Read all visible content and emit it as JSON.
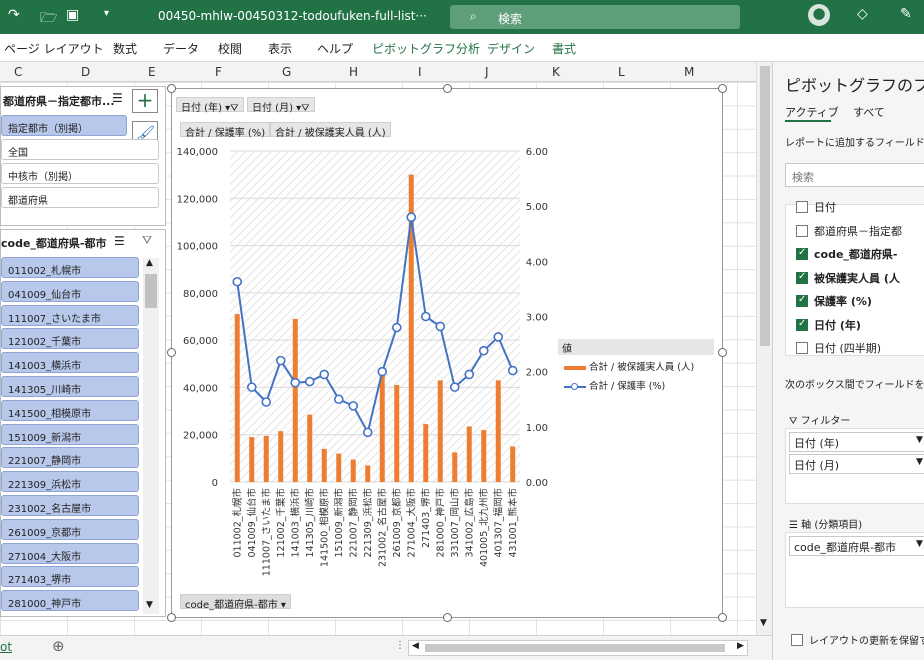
{
  "titlebar": {
    "filename": "00450-mhlw-00450312-todoufuken-full-list···",
    "search": "検索"
  },
  "ribbon": {
    "tabs": [
      "ページ レイアウト",
      "数式",
      "データ",
      "校閲",
      "表示",
      "ヘルプ",
      "ピボットグラフ分析",
      "デザイン",
      "書式"
    ]
  },
  "columns": [
    "C",
    "D",
    "E",
    "F",
    "G",
    "H",
    "I",
    "J",
    "K",
    "L",
    "M"
  ],
  "slicer1": {
    "title": "都道府県－指定都市...",
    "items": [
      "指定都市（別掲）",
      "全国",
      "中核市（別掲）",
      "都道府県"
    ]
  },
  "slicer2": {
    "title": "code_都道府県-都市",
    "items": [
      "011002_札幌市",
      "041009_仙台市",
      "111007_さいたま市",
      "121002_千葉市",
      "141003_横浜市",
      "141305_川崎市",
      "141500_相模原市",
      "151009_新潟市",
      "221007_静岡市",
      "221309_浜松市",
      "231002_名古屋市",
      "261009_京都市",
      "271004_大阪市",
      "271403_堺市",
      "281000_神戸市"
    ]
  },
  "chart": {
    "filter_buttons": [
      "日付 (年)",
      "日付 (月)"
    ],
    "value_buttons": [
      "合計 / 保護率 (%)",
      "合計 / 被保護実人員 (人)"
    ],
    "axis_button": "code_都道府県-都市",
    "legend_title": "値",
    "legend": [
      "合計 / 被保護実人員 (人)",
      "合計 / 保護率 (%)"
    ]
  },
  "chart_data": {
    "type": "bar",
    "categories": [
      "011002_札幌市",
      "041009_仙台市",
      "111007_さいたま市",
      "121002_千葉市",
      "141003_横浜市",
      "141305_川崎市",
      "141500_相模原市",
      "151009_新潟市",
      "221007_静岡市",
      "221309_浜松市",
      "231002_名古屋市",
      "261009_京都市",
      "271004_大阪市",
      "271403_堺市",
      "281000_神戸市",
      "331007_岡山市",
      "341002_広島市",
      "401005_北九州市",
      "401307_福岡市",
      "431001_熊本市"
    ],
    "series": [
      {
        "name": "合計 / 被保護実人員 (人)",
        "type": "bar",
        "axis": "left",
        "color": "#ED7D31",
        "values": [
          71000,
          19000,
          19500,
          21500,
          69000,
          28500,
          14000,
          12000,
          9500,
          7000,
          45000,
          41000,
          130000,
          24500,
          43000,
          12500,
          23500,
          22000,
          43000,
          15000
        ]
      },
      {
        "name": "合計 / 保護率 (%)",
        "type": "line",
        "axis": "right",
        "color": "#4472C4",
        "values": [
          3.63,
          1.72,
          1.45,
          2.2,
          1.8,
          1.82,
          1.95,
          1.5,
          1.38,
          0.9,
          2.0,
          2.8,
          4.8,
          3.0,
          2.82,
          1.72,
          1.95,
          2.38,
          2.63,
          2.02
        ]
      }
    ],
    "y_left": {
      "ticks": [
        "0",
        "20,000",
        "40,000",
        "60,000",
        "80,000",
        "100,000",
        "120,000",
        "140,000"
      ],
      "max": 140000
    },
    "y_right": {
      "ticks": [
        "0.00",
        "1.00",
        "2.00",
        "3.00",
        "4.00",
        "5.00",
        "6.00"
      ],
      "max": 6
    }
  },
  "pane": {
    "title": "ピボットグラフのフィ",
    "tabs": [
      "アクティブ",
      "すべて"
    ],
    "hint": "レポートに追加するフィールドを選",
    "search": "検索",
    "fields": [
      {
        "label": "日付",
        "checked": false
      },
      {
        "label": "都道府県－指定都",
        "checked": false
      },
      {
        "label": "code_都道府県-",
        "checked": true
      },
      {
        "label": "被保護実人員 (人",
        "checked": true
      },
      {
        "label": "保護率 (%)",
        "checked": true
      },
      {
        "label": "日付 (年)",
        "checked": true
      },
      {
        "label": "日付 (四半期)",
        "checked": false
      }
    ],
    "drag_hint": "次のボックス間でフィールドをドラ",
    "filter_label": "フィルター",
    "filters": [
      "日付 (年)",
      "日付 (月)"
    ],
    "axis_label": "軸 (分類項目)",
    "axis_items": [
      "code_都道府県-都市"
    ],
    "defer": "レイアウトの更新を保留す"
  },
  "status": {
    "sheet": "ot"
  }
}
